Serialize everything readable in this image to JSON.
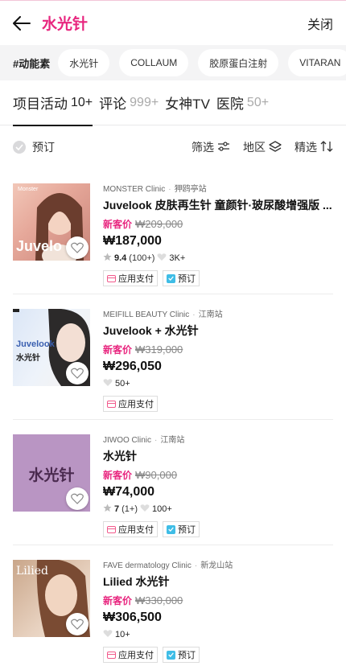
{
  "header": {
    "title": "水光针",
    "close_label": "关闭"
  },
  "chips": {
    "label": "#动能素",
    "items": [
      "水光针",
      "COLLAUM",
      "胶原蛋白注射",
      "VITARAN"
    ]
  },
  "tabs": [
    {
      "label": "项目活动",
      "count": "10+",
      "active": true
    },
    {
      "label": "评论",
      "count": "999+"
    },
    {
      "label": "女神TV",
      "count": ""
    },
    {
      "label": "医院",
      "count": "50+"
    }
  ],
  "filters": {
    "reserve_label": "预订",
    "filter_label": "筛选",
    "region_label": "地区",
    "sort_label": "精选"
  },
  "labels": {
    "new_customer": "新客价",
    "pay": "应用支付",
    "reserve": "预订"
  },
  "products": [
    {
      "clinic": "MONSTER Clinic",
      "station": "狎鸥亭站",
      "name": "Juvelook 皮肤再生针 童颜针·玻尿酸增强版 ...",
      "old_price": "₩209,000",
      "price": "₩187,000",
      "rating": "9.4",
      "reviews": "(100+)",
      "likes": "3K+",
      "thumb_text": "Juvelo",
      "thumb_top": "Monster",
      "has_reserve": true
    },
    {
      "clinic": "MEIFILL BEAUTY Clinic",
      "station": "江南站",
      "name": "Juvelook + 水光针",
      "old_price": "₩319,000",
      "price": "₩296,050",
      "rating": "",
      "reviews": "",
      "likes": "50+",
      "thumb_text": "Juvelook",
      "thumb_sub": "水光针",
      "has_reserve": false
    },
    {
      "clinic": "JIWOO Clinic",
      "station": "江南站",
      "name": "水光针",
      "old_price": "₩90,000",
      "price": "₩74,000",
      "rating": "7",
      "reviews": "(1+)",
      "likes": "100+",
      "thumb_text": "水光针",
      "has_reserve": true
    },
    {
      "clinic": "FAVE dermatology Clinic",
      "station": "新龙山站",
      "name": "Lilied 水光针",
      "old_price": "₩330,000",
      "price": "₩306,500",
      "rating": "",
      "reviews": "",
      "likes": "10+",
      "thumb_text": "Lilied",
      "has_reserve": true
    }
  ],
  "colors": {
    "accent": "#e8267f",
    "thumb3": "#b995c3"
  }
}
